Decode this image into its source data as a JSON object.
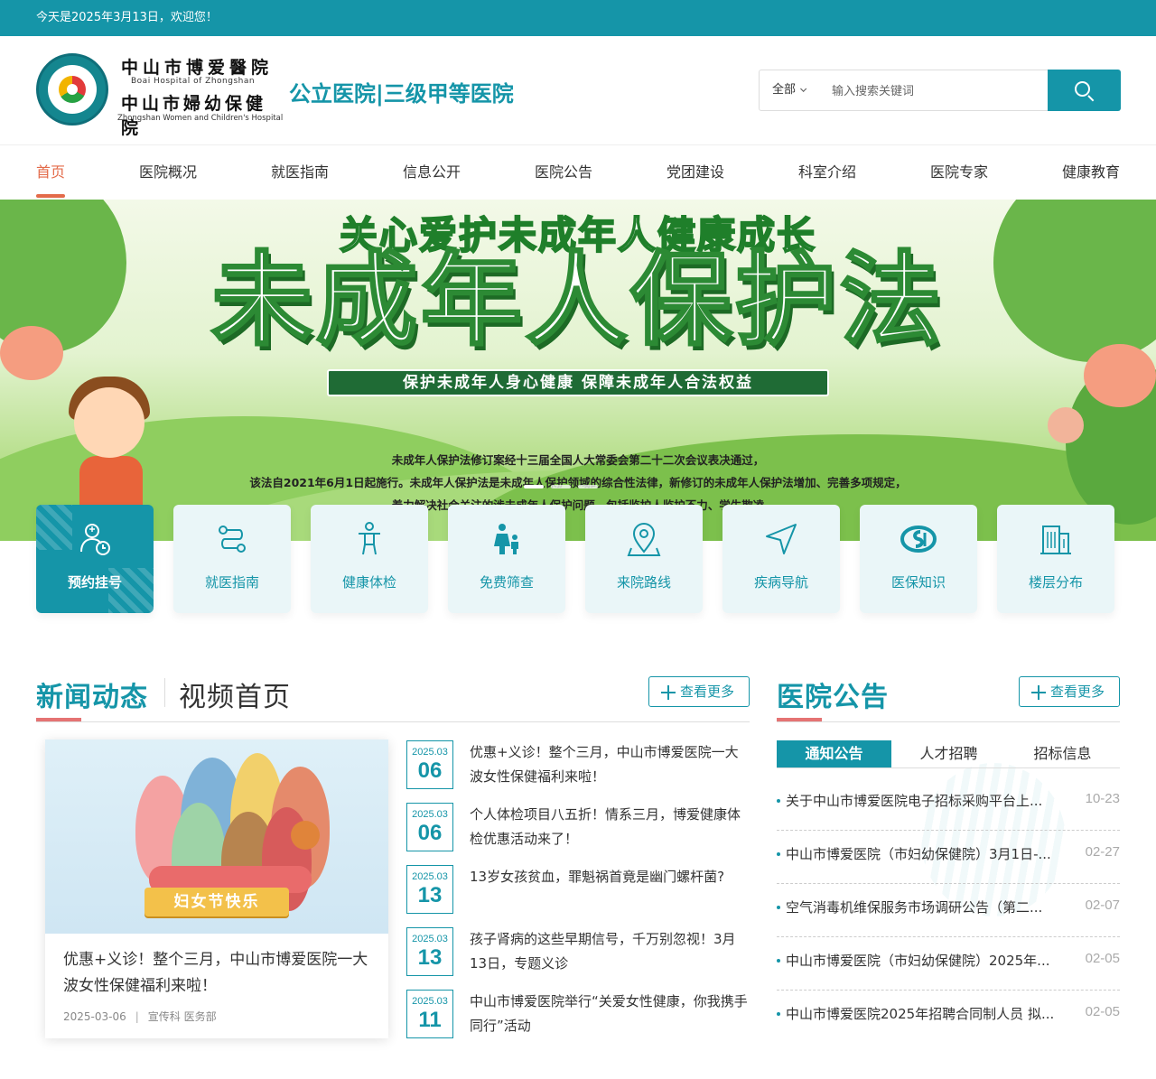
{
  "topbar": {
    "welcome": "今天是2025年3月13日，欢迎您！"
  },
  "header": {
    "logo_cn_1": "中山市博爱醫院",
    "logo_en_1": "Boai Hospital of Zhongshan",
    "logo_cn_2": "中山市婦幼保健院",
    "logo_en_2": "Zhongshan Women and Children's Hospital",
    "slogan": "公立医院|三级甲等医院"
  },
  "search": {
    "scope": "全部",
    "placeholder": "输入搜索关键词",
    "icon": "search-icon"
  },
  "nav": {
    "items": [
      {
        "label": "首页",
        "active": true
      },
      {
        "label": "医院概况"
      },
      {
        "label": "就医指南"
      },
      {
        "label": "信息公开"
      },
      {
        "label": "医院公告"
      },
      {
        "label": "党团建设"
      },
      {
        "label": "科室介绍"
      },
      {
        "label": "医院专家"
      },
      {
        "label": "健康教育"
      }
    ]
  },
  "banner": {
    "headline_top": "关心爱护未成年人健康成长",
    "headline_main": "未成年人保护法",
    "subtitle": "保护未成年人身心健康 保障未成年人合法权益",
    "para_1": "未成年人保护法修订案经十三届全国人大常委会第二十二次会议表决通过，",
    "para_2": "该法自2021年6月1日起施行。未成年人保护法是未成年人保护领域的综合性法律，新修订的未成年人保护法增加、完善多项规定，",
    "para_3": "着力解决社会关注的涉未成年人保护问题，包括监护人监护不力、学生欺凌"
  },
  "quick_links": [
    {
      "label": "预约挂号",
      "icon": "doctor-clock-icon",
      "primary": true
    },
    {
      "label": "就医指南",
      "icon": "route-icon"
    },
    {
      "label": "健康体检",
      "icon": "person-icon"
    },
    {
      "label": "免费筛查",
      "icon": "family-icon"
    },
    {
      "label": "来院路线",
      "icon": "map-pin-icon"
    },
    {
      "label": "疾病导航",
      "icon": "navigation-arrow-icon"
    },
    {
      "label": "医保知识",
      "icon": "social-insurance-icon"
    },
    {
      "label": "楼层分布",
      "icon": "building-icon"
    }
  ],
  "news_section": {
    "title": "新闻动态",
    "alt_title": "视频首页",
    "more": "查看更多",
    "feature": {
      "image_caption": "妇女节快乐",
      "title": "优惠+义诊！整个三月，中山市博爱医院一大波女性保健福利来啦！",
      "date": "2025-03-06",
      "source": "宣传科 医务部"
    },
    "items": [
      {
        "ym": "2025.03",
        "day": "06",
        "title": "优惠+义诊！整个三月，中山市博爱医院一大波女性保健福利来啦！"
      },
      {
        "ym": "2025.03",
        "day": "06",
        "title": "个人体检项目八五折！情系三月，博爱健康体检优惠活动来了！"
      },
      {
        "ym": "2025.03",
        "day": "13",
        "title": "13岁女孩贫血，罪魁祸首竟是幽门螺杆菌?"
      },
      {
        "ym": "2025.03",
        "day": "13",
        "title": "孩子肾病的这些早期信号，千万别忽视！3月13日，专题义诊"
      },
      {
        "ym": "2025.03",
        "day": "11",
        "title": "中山市博爱医院举行“关爱女性健康，你我携手同行”活动"
      }
    ]
  },
  "notice_section": {
    "title": "医院公告",
    "more": "查看更多",
    "tabs": [
      "通知公告",
      "人才招聘",
      "招标信息"
    ],
    "items": [
      {
        "title": "关于中山市博爱医院电子招标采购平台上...",
        "date": "10-23"
      },
      {
        "title": "中山市博爱医院（市妇幼保健院）3月1日-...",
        "date": "02-27"
      },
      {
        "title": "空气消毒机维保服务市场调研公告（第二...",
        "date": "02-07"
      },
      {
        "title": "中山市博爱医院（市妇幼保健院）2025年...",
        "date": "02-05"
      },
      {
        "title": "中山市博爱医院2025年招聘合同制人员 拟...",
        "date": "02-05"
      }
    ]
  },
  "colors": {
    "primary": "#1595a8",
    "accent": "#e36b4a",
    "divider_accent": "#e57373"
  }
}
